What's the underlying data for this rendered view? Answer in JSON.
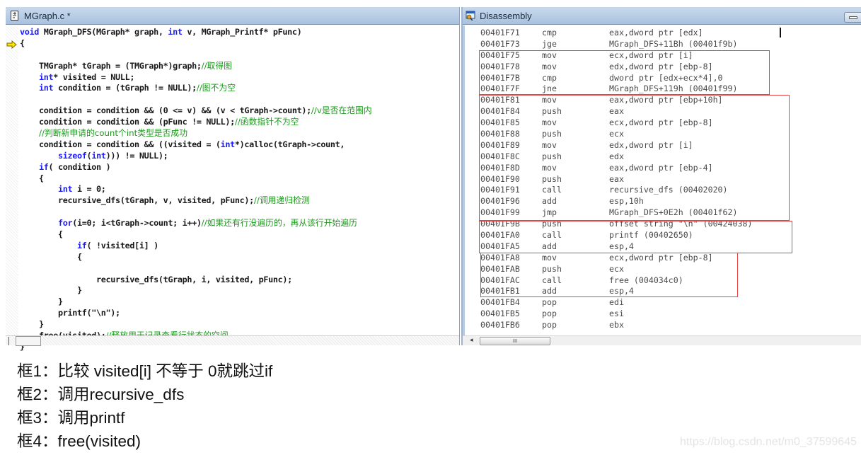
{
  "editor": {
    "title": "MGraph.c *",
    "icon": "c-source-file-icon",
    "lines": [
      [
        {
          "t": "void",
          "c": "kw"
        },
        {
          "t": " MGraph_DFS(MGraph* graph, "
        },
        {
          "t": "int",
          "c": "kw"
        },
        {
          "t": " v, MGraph_Printf* pFunc)"
        }
      ],
      [
        {
          "t": "{"
        }
      ],
      [
        {
          "t": ""
        }
      ],
      [
        {
          "t": "    TMGraph* tGraph = (TMGraph*)graph;"
        },
        {
          "t": "//取得图",
          "c": "cm"
        }
      ],
      [
        {
          "t": "    "
        },
        {
          "t": "int",
          "c": "kw"
        },
        {
          "t": "* visited = NULL;"
        }
      ],
      [
        {
          "t": "    "
        },
        {
          "t": "int",
          "c": "kw"
        },
        {
          "t": " condition = (tGraph != NULL);"
        },
        {
          "t": "//图不为空",
          "c": "cm"
        }
      ],
      [
        {
          "t": ""
        }
      ],
      [
        {
          "t": "    condition = condition && (0 <= v) && (v < tGraph->count);"
        },
        {
          "t": "//v是否在范围内",
          "c": "cm"
        }
      ],
      [
        {
          "t": "    condition = condition && (pFunc != NULL);"
        },
        {
          "t": "//函数指针不为空",
          "c": "cm"
        }
      ],
      [
        {
          "t": "    "
        },
        {
          "t": "//判断新申请的count个int类型是否成功",
          "c": "cm"
        }
      ],
      [
        {
          "t": "    condition = condition && ((visited = ("
        },
        {
          "t": "int",
          "c": "kw"
        },
        {
          "t": "*)calloc(tGraph->count,"
        }
      ],
      [
        {
          "t": "        "
        },
        {
          "t": "sizeof",
          "c": "kw"
        },
        {
          "t": "("
        },
        {
          "t": "int",
          "c": "kw"
        },
        {
          "t": "))) != NULL);"
        }
      ],
      [
        {
          "t": "    "
        },
        {
          "t": "if",
          "c": "kw"
        },
        {
          "t": "( condition )"
        }
      ],
      [
        {
          "t": "    {"
        }
      ],
      [
        {
          "t": "        "
        },
        {
          "t": "int",
          "c": "kw"
        },
        {
          "t": " i = 0;"
        }
      ],
      [
        {
          "t": "        recursive_dfs(tGraph, v, visited, pFunc);"
        },
        {
          "t": "//调用递归检测",
          "c": "cm"
        }
      ],
      [
        {
          "t": ""
        }
      ],
      [
        {
          "t": "        "
        },
        {
          "t": "for",
          "c": "kw"
        },
        {
          "t": "(i=0; i<tGraph->count; i++)"
        },
        {
          "t": "//如果还有行没遍历的，再从该行开始遍历",
          "c": "cm"
        }
      ],
      [
        {
          "t": "        {"
        }
      ],
      [
        {
          "t": "            "
        },
        {
          "t": "if",
          "c": "kw"
        },
        {
          "t": "( !visited[i] )"
        }
      ],
      [
        {
          "t": "            {"
        }
      ],
      [
        {
          "t": ""
        }
      ],
      [
        {
          "t": "                recursive_dfs(tGraph, i, visited, pFunc);"
        }
      ],
      [
        {
          "t": "            }"
        }
      ],
      [
        {
          "t": "        }"
        }
      ],
      [
        {
          "t": "        printf(\"\\n\");"
        }
      ],
      [
        {
          "t": "    }"
        }
      ],
      [
        {
          "t": "    free(visited);"
        },
        {
          "t": "//释放用于记录查看行状态的空间",
          "c": "cm"
        }
      ],
      [
        {
          "t": "}"
        }
      ]
    ],
    "current_line_marker": "yellow-arrow-icon"
  },
  "disassembly": {
    "title": "Disassembly",
    "icon": "disassembly-window-icon",
    "rows": [
      {
        "addr": "00401F71",
        "op": "cmp",
        "arg": "eax,dword ptr [edx]"
      },
      {
        "addr": "00401F73",
        "op": "jge",
        "arg": "MGraph_DFS+11Bh (00401f9b)"
      },
      {
        "addr": "00401F75",
        "op": "mov",
        "arg": "ecx,dword ptr [i]"
      },
      {
        "addr": "00401F78",
        "op": "mov",
        "arg": "edx,dword ptr [ebp-8]"
      },
      {
        "addr": "00401F7B",
        "op": "cmp",
        "arg": "dword ptr [edx+ecx*4],0"
      },
      {
        "addr": "00401F7F",
        "op": "jne",
        "arg": "MGraph_DFS+119h (00401f99)"
      },
      {
        "addr": "00401F81",
        "op": "mov",
        "arg": "eax,dword ptr [ebp+10h]"
      },
      {
        "addr": "00401F84",
        "op": "push",
        "arg": "eax"
      },
      {
        "addr": "00401F85",
        "op": "mov",
        "arg": "ecx,dword ptr [ebp-8]"
      },
      {
        "addr": "00401F88",
        "op": "push",
        "arg": "ecx"
      },
      {
        "addr": "00401F89",
        "op": "mov",
        "arg": "edx,dword ptr [i]"
      },
      {
        "addr": "00401F8C",
        "op": "push",
        "arg": "edx"
      },
      {
        "addr": "00401F8D",
        "op": "mov",
        "arg": "eax,dword ptr [ebp-4]"
      },
      {
        "addr": "00401F90",
        "op": "push",
        "arg": "eax"
      },
      {
        "addr": "00401F91",
        "op": "call",
        "arg": "recursive_dfs (00402020)"
      },
      {
        "addr": "00401F96",
        "op": "add",
        "arg": "esp,10h"
      },
      {
        "addr": "00401F99",
        "op": "jmp",
        "arg": "MGraph_DFS+0E2h (00401f62)"
      },
      {
        "addr": "00401F9B",
        "op": "push",
        "arg": "offset string \"\\n\" (00424038)"
      },
      {
        "addr": "00401FA0",
        "op": "call",
        "arg": "printf (00402650)"
      },
      {
        "addr": "00401FA5",
        "op": "add",
        "arg": "esp,4"
      },
      {
        "addr": "00401FA8",
        "op": "mov",
        "arg": "ecx,dword ptr [ebp-8]"
      },
      {
        "addr": "00401FAB",
        "op": "push",
        "arg": "ecx"
      },
      {
        "addr": "00401FAC",
        "op": "call",
        "arg": "free (004034c0)"
      },
      {
        "addr": "00401FB1",
        "op": "add",
        "arg": "esp,4"
      },
      {
        "addr": "00401FB4",
        "op": "pop",
        "arg": "edi"
      },
      {
        "addr": "00401FB5",
        "op": "pop",
        "arg": "esi"
      },
      {
        "addr": "00401FB6",
        "op": "pop",
        "arg": "ebx"
      }
    ],
    "highlight_color": "#e64444",
    "scroll_thumb_glyph": "III"
  },
  "notes": [
    "框1：比较 visited[i] 不等于 0就跳过if",
    "框2：调用recursive_dfs",
    "框3：调用printf",
    "框4：free(visited)"
  ],
  "watermark": "https://blog.csdn.net/m0_37599645"
}
